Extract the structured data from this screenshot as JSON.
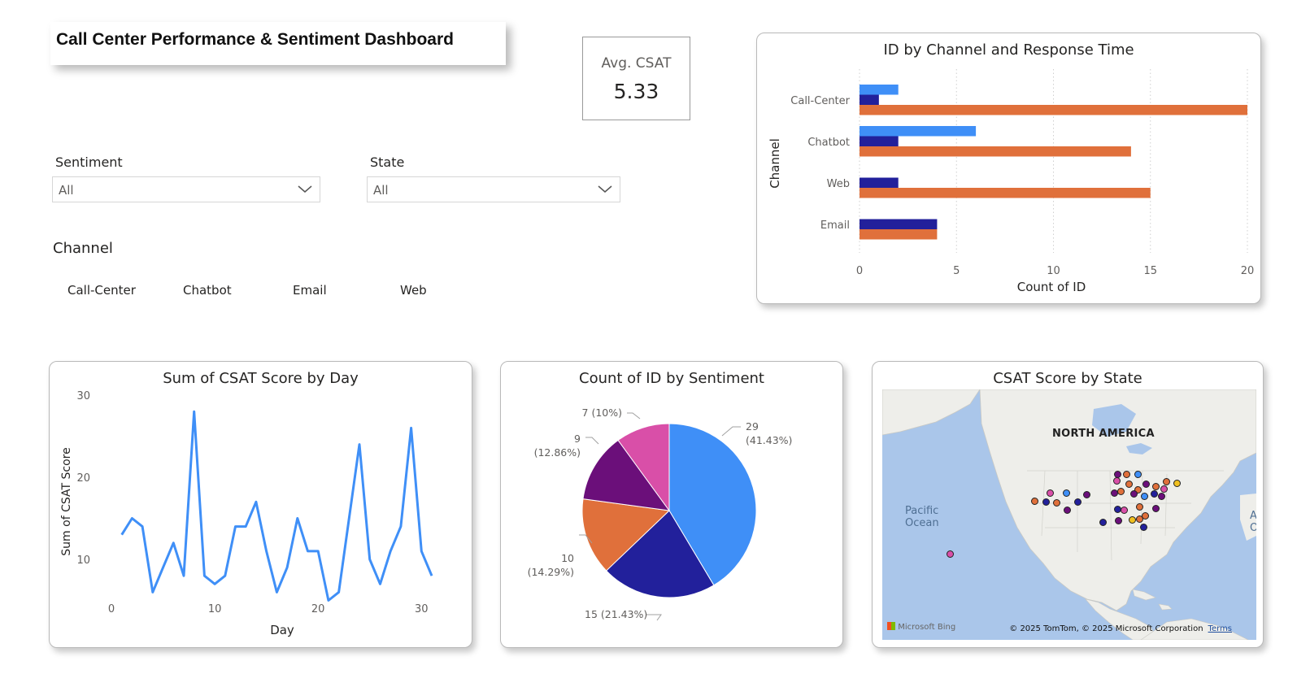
{
  "header": {
    "title": "Call Center Performance & Sentiment Dashboard"
  },
  "kpi": {
    "label": "Avg. CSAT",
    "value": "5.33"
  },
  "slicers": {
    "sentiment": {
      "title": "Sentiment",
      "selected": "All"
    },
    "state": {
      "title": "State",
      "selected": "All"
    },
    "channel": {
      "title": "Channel",
      "options": [
        "Call-Center",
        "Chatbot",
        "Email",
        "Web"
      ]
    }
  },
  "colors": {
    "series_light_blue": "#3f8ff7",
    "series_navy": "#22209b",
    "series_orange": "#e0703b",
    "pie_positive": "#3f8ff7",
    "pie_negative": "#22209b",
    "pie_neutral": "#e0703b",
    "pie_very_negative": "#6b0f7a",
    "pie_very_positive": "#d94fa8",
    "map_water": "#aac6ea",
    "map_land": "#eeeeea"
  },
  "map": {
    "title": "CSAT Score by State",
    "region_label": "NORTH AMERICA",
    "ocean_label_1": "Pacific",
    "ocean_label_2": "Ocean",
    "edge_label_1": "A",
    "edge_label_2": "O",
    "logo": "Microsoft Bing",
    "copyright": "© 2025 TomTom, © 2025 Microsoft Corporation",
    "terms": "Terms"
  },
  "chart_data": [
    {
      "type": "bar",
      "title": "ID by Channel and Response Time",
      "xlabel": "Count of ID",
      "ylabel": "Channel",
      "orientation": "horizontal",
      "xlim": [
        0,
        20
      ],
      "xticks": [
        "0",
        "5",
        "10",
        "15",
        "20"
      ],
      "grid": "vertical dotted",
      "legend": "none",
      "categories": [
        "Call-Center",
        "Chatbot",
        "Web",
        "Email"
      ],
      "series": [
        {
          "values": [
            2,
            6,
            0,
            0
          ],
          "color": "#3f8ff7"
        },
        {
          "values": [
            1,
            2,
            2,
            4
          ],
          "color": "#22209b"
        },
        {
          "values": [
            20,
            14,
            15,
            4
          ],
          "color": "#e0703b"
        }
      ]
    },
    {
      "type": "line",
      "title": "Sum of CSAT Score by Day",
      "xlabel": "Day",
      "ylabel": "Sum of CSAT Score",
      "xlim": [
        0,
        31
      ],
      "ylim": [
        5,
        30
      ],
      "xticks": [
        "0",
        "10",
        "20",
        "30"
      ],
      "yticks": [
        "10",
        "20",
        "30"
      ],
      "x": [
        1,
        2,
        3,
        4,
        5,
        6,
        7,
        8,
        9,
        10,
        11,
        12,
        13,
        14,
        15,
        16,
        17,
        18,
        19,
        20,
        21,
        22,
        23,
        24,
        25,
        26,
        27,
        28,
        29,
        30,
        31
      ],
      "series": [
        {
          "values": [
            13,
            15,
            14,
            6,
            9,
            12,
            8,
            28,
            8,
            7,
            8,
            14,
            14,
            17,
            11,
            6,
            9,
            15,
            11,
            11,
            5,
            6,
            15,
            24,
            10,
            7,
            11,
            14,
            26,
            11,
            8
          ],
          "color": "#3f8ff7"
        }
      ]
    },
    {
      "type": "pie",
      "title": "Count of ID by Sentiment",
      "slices": [
        {
          "value": 29,
          "label_value": "29",
          "label_pct": "(41.43%)",
          "color": "#3f8ff7"
        },
        {
          "value": 15,
          "label_value": "15 (21.43%)",
          "label_pct": "",
          "color": "#22209b"
        },
        {
          "value": 10,
          "label_value": "10",
          "label_pct": "(14.29%)",
          "color": "#e0703b"
        },
        {
          "value": 9,
          "label_value": "9",
          "label_pct": "(12.86%)",
          "color": "#6b0f7a"
        },
        {
          "value": 7,
          "label_value": "7 (10%)",
          "label_pct": "",
          "color": "#d94fa8"
        }
      ]
    }
  ]
}
